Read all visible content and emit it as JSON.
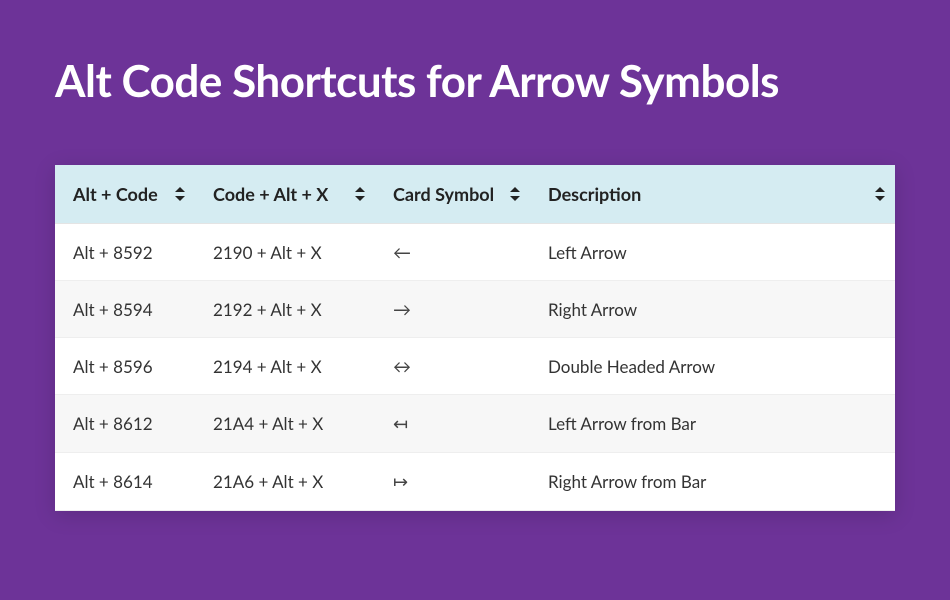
{
  "title": "Alt Code Shortcuts for Arrow Symbols",
  "table": {
    "headers": {
      "alt": "Alt + Code",
      "hex": "Code + Alt + X",
      "sym": "Card Symbol",
      "desc": "Description"
    },
    "rows": [
      {
        "alt": "Alt + 8592",
        "hex": "2190 + Alt + X",
        "sym": "←",
        "desc": "Left Arrow"
      },
      {
        "alt": "Alt + 8594",
        "hex": "2192 + Alt + X",
        "sym": "→",
        "desc": "Right Arrow"
      },
      {
        "alt": "Alt + 8596",
        "hex": "2194 + Alt + X",
        "sym": "↔",
        "desc": "Double Headed Arrow"
      },
      {
        "alt": "Alt + 8612",
        "hex": "21A4 + Alt + X",
        "sym": "↤",
        "desc": "Left Arrow from Bar"
      },
      {
        "alt": "Alt + 8614",
        "hex": "21A6 + Alt + X",
        "sym": "↦",
        "desc": "Right Arrow from Bar"
      }
    ]
  }
}
